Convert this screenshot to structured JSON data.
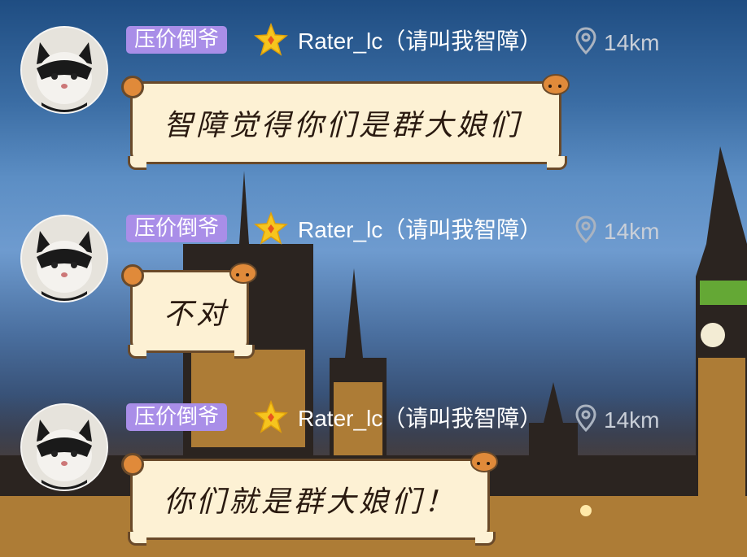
{
  "messages": [
    {
      "tag": "压价倒爷",
      "username": "Rater_lc（请叫我智障）",
      "distance": "14km",
      "text": "智障觉得你们是群大娘们"
    },
    {
      "tag": "压价倒爷",
      "username": "Rater_lc（请叫我智障）",
      "distance": "14km",
      "text": "不对"
    },
    {
      "tag": "压价倒爷",
      "username": "Rater_lc（请叫我智障）",
      "distance": "14km",
      "text": "你们就是群大娘们！"
    }
  ],
  "colors": {
    "tag_bg": "#a98ee8",
    "bubble_bg": "#fdf1d4",
    "bubble_border": "#6a4a2a",
    "distance_text": "#c9cfd8"
  },
  "icons": {
    "star": "star-icon",
    "location": "location-pin-icon",
    "avatar": "cat-avatar-icon"
  }
}
